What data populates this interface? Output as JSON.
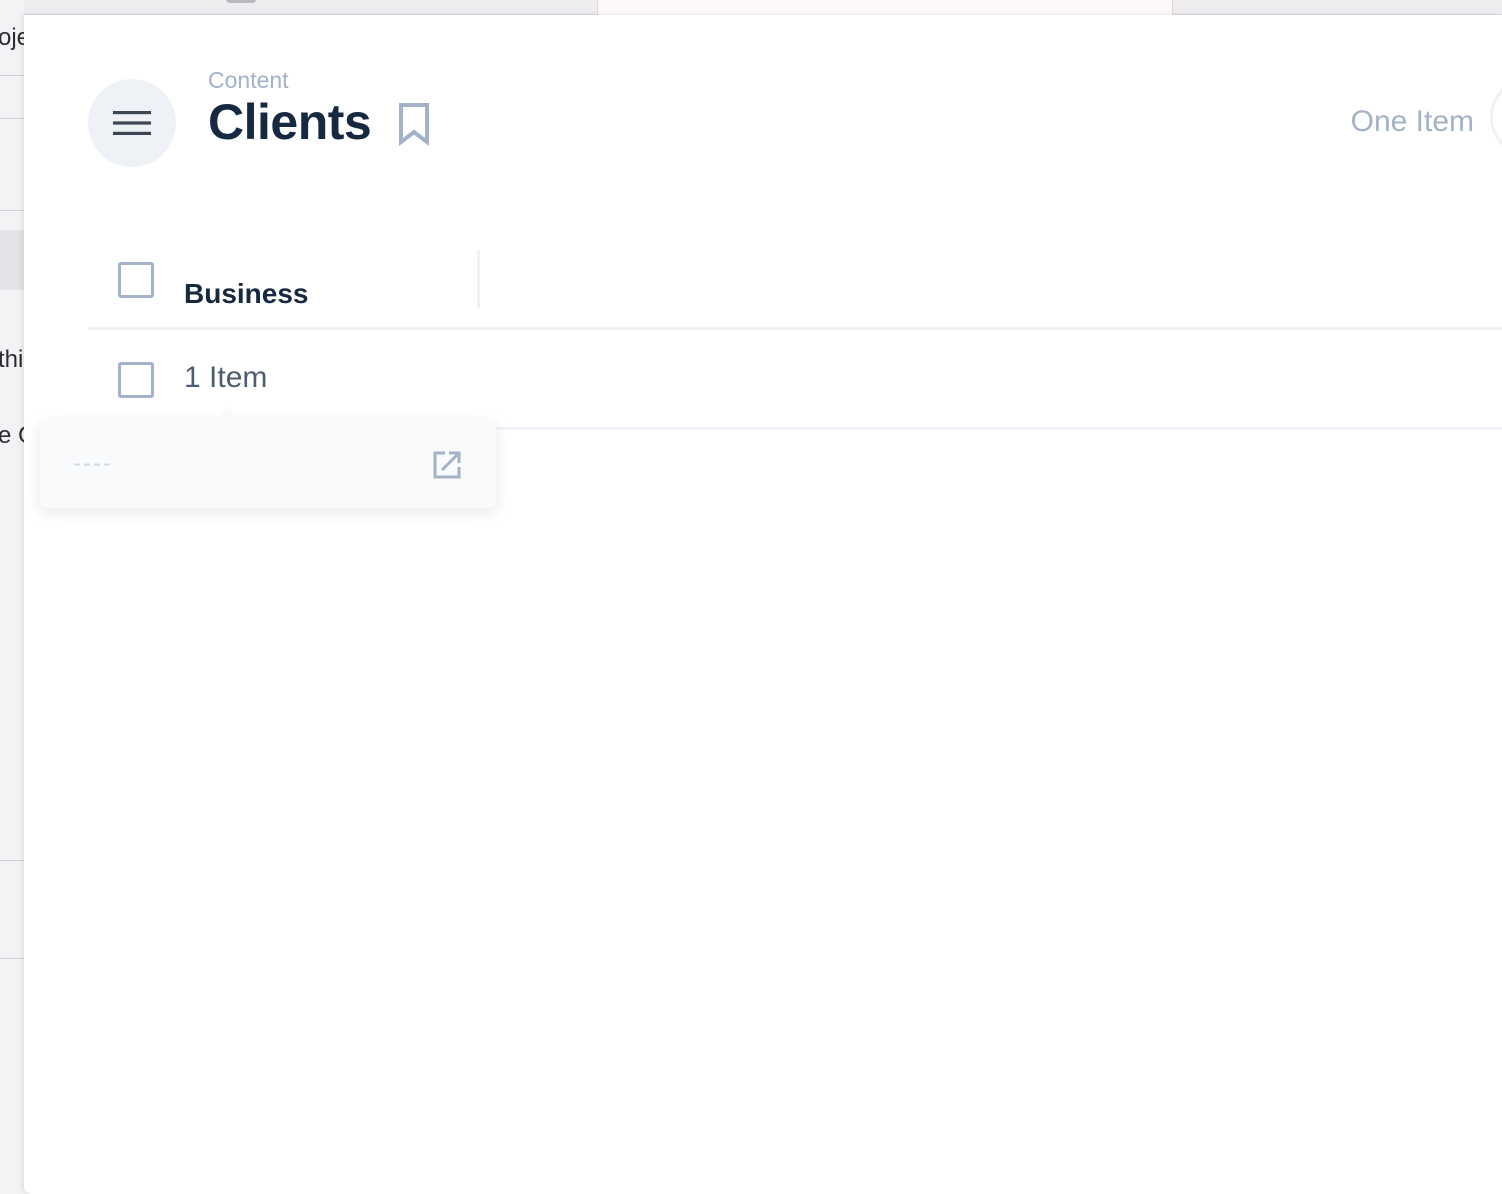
{
  "background": {
    "text_fragments": [
      "oje",
      "thi",
      "e C"
    ]
  },
  "header": {
    "breadcrumb": "Content",
    "title": "Clients",
    "item_count": "One Item",
    "menu_icon": "menu-icon",
    "bookmark_icon": "bookmark-icon"
  },
  "table": {
    "columns": [
      "Business"
    ],
    "rows": [
      {
        "business": "1 Item"
      }
    ]
  },
  "popover": {
    "placeholder": "----",
    "open_icon": "external-link-icon"
  },
  "colors": {
    "title": "#172940",
    "muted": "#a3b2c7",
    "subtle_bg": "#eef2f6"
  }
}
